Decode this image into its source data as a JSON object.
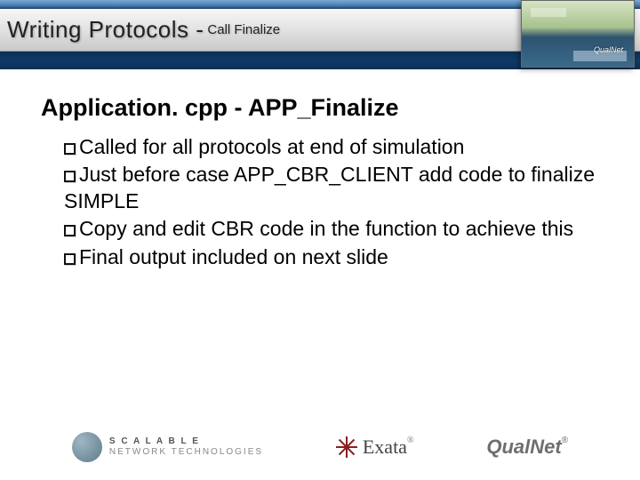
{
  "header": {
    "title_main": "Writing Protocols - ",
    "title_sub": "Call Finalize",
    "corner_label": "QualNet"
  },
  "content": {
    "heading": "Application. cpp - APP_Finalize",
    "bullets": [
      "Called for all protocols at end of simulation",
      "Just before case APP_CBR_CLIENT add code to finalize SIMPLE",
      "Copy and edit CBR code in the function to achieve this",
      "Final output included on next slide"
    ]
  },
  "logos": {
    "scalable_l1": "S C A L A B L E",
    "scalable_l2": "NETWORK TECHNOLOGIES",
    "exata": "Exata",
    "qualnet": "QualNet"
  }
}
